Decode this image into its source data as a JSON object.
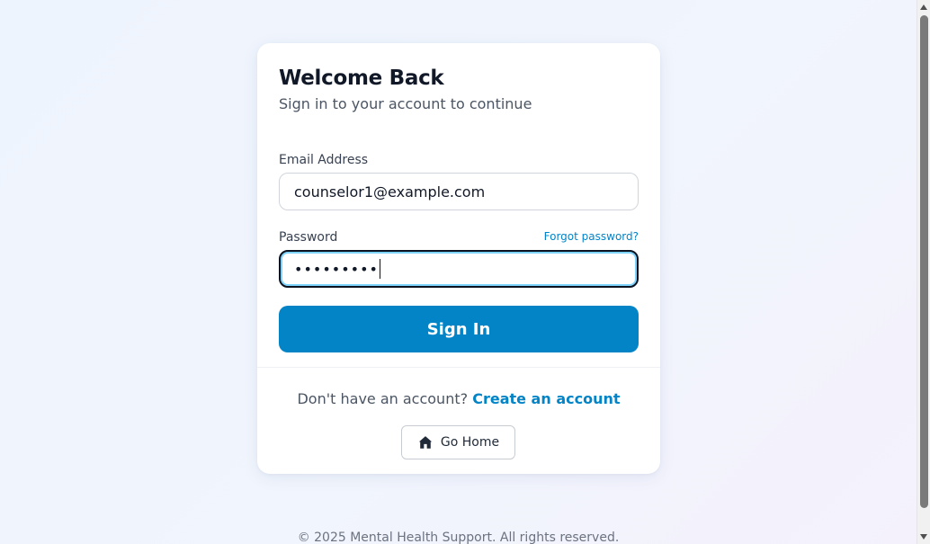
{
  "card": {
    "title": "Welcome Back",
    "subtitle": "Sign in to your account to continue"
  },
  "form": {
    "email_label": "Email Address",
    "email_value": "counselor1@example.com",
    "password_label": "Password",
    "password_masked": "•••••••••",
    "forgot_label": "Forgot password?",
    "submit_label": "Sign In"
  },
  "signup": {
    "prompt": "Don't have an account?",
    "link_label": "Create an account"
  },
  "home_button": {
    "label": "Go Home",
    "icon": "home-icon"
  },
  "footer": {
    "text": "© 2025 Mental Health Support. All rights reserved."
  },
  "colors": {
    "accent": "#0284c7",
    "title": "#111827",
    "muted": "#4b5563"
  }
}
